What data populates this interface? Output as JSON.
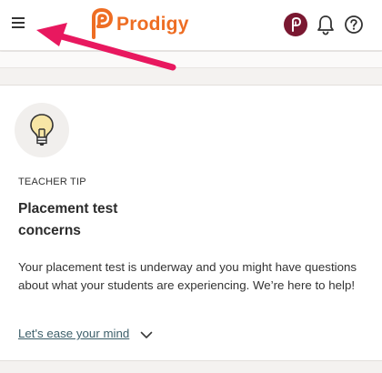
{
  "header": {
    "brand": "Prodigy",
    "brand_color": "#ee6d23",
    "avatar_color": "#7a1831",
    "icons": [
      "hamburger-menu-icon",
      "prodigy-logo-icon",
      "profile-avatar-icon",
      "bell-icon",
      "help-icon"
    ]
  },
  "tip_card": {
    "eyebrow": "TEACHER TIP",
    "title": "Placement test concerns",
    "body": "Your placement test is underway and you might have questions about what your students are experiencing. We’re here to help!",
    "link_label": "Let's ease your mind",
    "icons": [
      "lightbulb-icon",
      "chevron-down-icon"
    ]
  },
  "annotation": {
    "arrow_color": "#e8185f"
  }
}
